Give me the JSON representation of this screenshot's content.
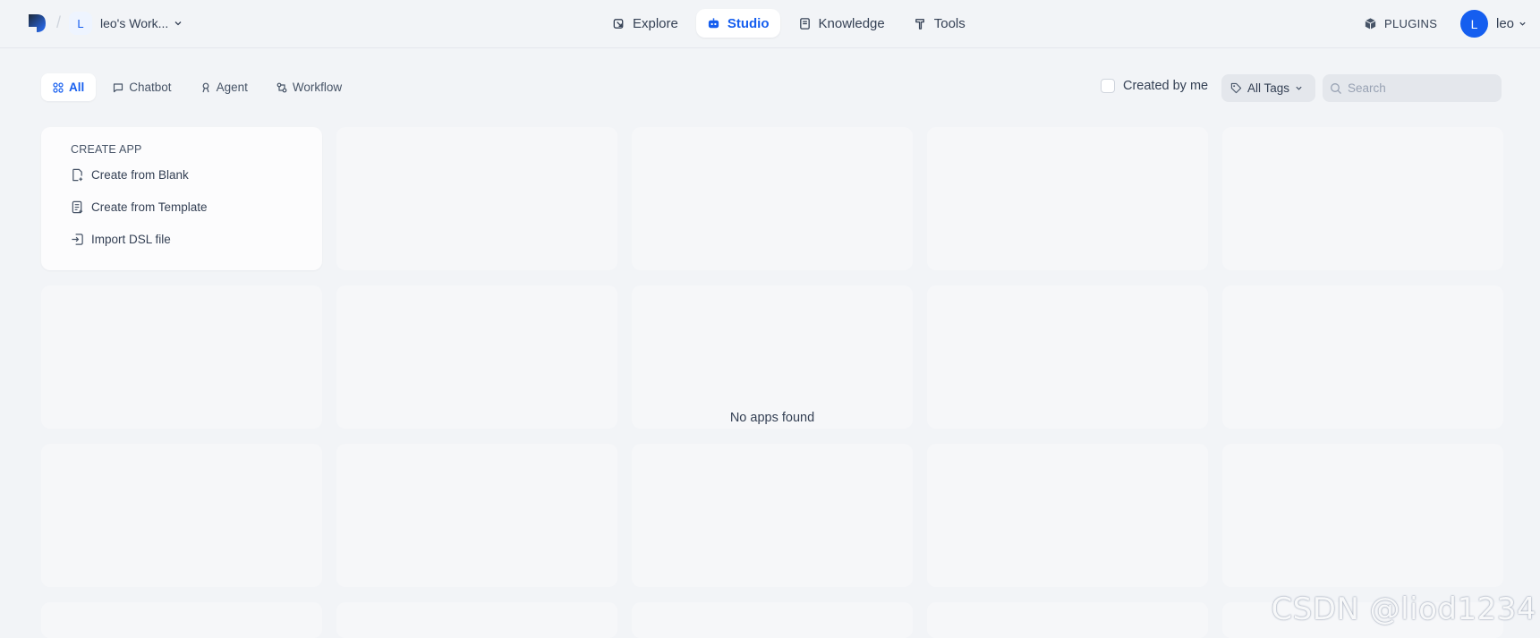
{
  "header": {
    "workspace": {
      "initial": "L",
      "name": "leo's Work..."
    },
    "nav": [
      {
        "label": "Explore",
        "icon": "explore-icon",
        "active": false
      },
      {
        "label": "Studio",
        "icon": "robot-icon",
        "active": true
      },
      {
        "label": "Knowledge",
        "icon": "book-icon",
        "active": false
      },
      {
        "label": "Tools",
        "icon": "hammer-icon",
        "active": false
      }
    ],
    "plugins_label": "PLUGINS",
    "user": {
      "initial": "L",
      "name": "leo"
    }
  },
  "toolbar": {
    "tabs": [
      {
        "label": "All",
        "icon": "grid-icon",
        "active": true
      },
      {
        "label": "Chatbot",
        "icon": "chat-bubble-icon",
        "active": false
      },
      {
        "label": "Agent",
        "icon": "agent-icon",
        "active": false
      },
      {
        "label": "Workflow",
        "icon": "workflow-icon",
        "active": false
      }
    ],
    "created_by_me": {
      "label": "Created by me",
      "checked": false
    },
    "tags_label": "All Tags",
    "search_placeholder": "Search"
  },
  "create_app": {
    "title": "CREATE APP",
    "items": [
      {
        "label": "Create from Blank",
        "icon": "file-plus-icon"
      },
      {
        "label": "Create from Template",
        "icon": "template-icon"
      },
      {
        "label": "Import DSL file",
        "icon": "import-icon"
      }
    ]
  },
  "empty_message": "No apps found",
  "watermark": "CSDN @liod1234",
  "colors": {
    "accent": "#155eef",
    "background": "#f2f4f7",
    "placeholder_card": "#f6f7f9"
  }
}
